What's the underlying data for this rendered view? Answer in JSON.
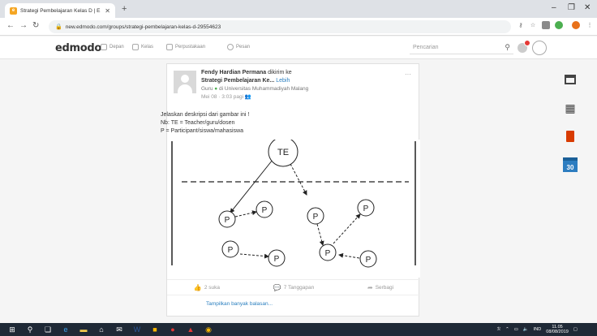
{
  "browser": {
    "tab_title": "Strategi Pembelajaran Kelas D | E",
    "tab_favicon": "e",
    "new_tab": "+",
    "url": "new.edmodo.com/groups/strategi-pembelajaran-kelas-d-29554623",
    "minimize": "–",
    "restore": "❐",
    "close": "✕"
  },
  "edmodo": {
    "logo": "edmodo",
    "nav": [
      {
        "label": "Depan"
      },
      {
        "label": "Kelas"
      },
      {
        "label": "Perpustakaan"
      },
      {
        "label": "Pesan"
      }
    ],
    "search_placeholder": "Pencarian"
  },
  "post": {
    "author_name": "Fendy Hardian Permana",
    "author_suffix": " dikirim ke",
    "group": "Strategi Pembelajaran Ke...",
    "group_more": "Lebih",
    "role": "Guru",
    "role_at": "di Universitas Muhammadiyah Malang",
    "time": "Mei 08 · 3:03 pagi",
    "lines": [
      "Jelaskan deskripsi dari gambar ini !",
      "Nb: TE = Teacher/guru/dosen",
      "P = Participant/siswa/mahasiswa"
    ],
    "diagram": {
      "teacher_label": "TE",
      "participant_label": "P"
    },
    "actions": {
      "like": "2 suka",
      "comment": "7 Tanggapan",
      "share": "Serbagi"
    },
    "more_replies": "Tampilkan banyak balasan..."
  },
  "right_apps": {
    "calendar_day": "30"
  },
  "taskbar": {
    "lang": "IND",
    "time": "11.05",
    "date": "08/08/2019"
  },
  "colors": {
    "accent": "#2a7fbf",
    "office": "#d83b01",
    "calendar": "#2d7dc0"
  }
}
